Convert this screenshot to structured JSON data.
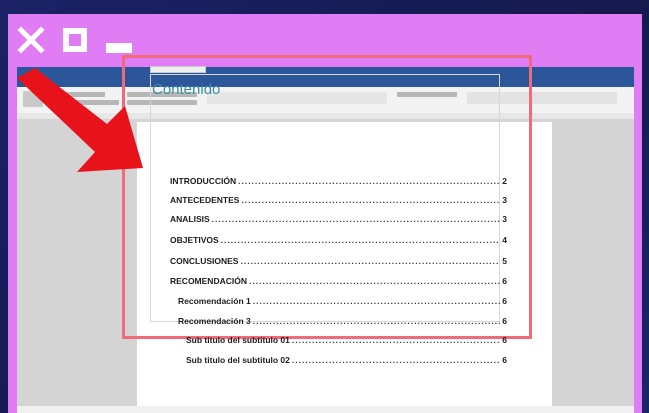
{
  "window_controls": {
    "close_icon": "close-x-icon",
    "maximize_icon": "maximize-square-icon",
    "minimize_icon": "minimize-bar-icon",
    "icon_color": "#ffffff"
  },
  "colors": {
    "frame": "#e07df5",
    "word_blue": "#2b579a",
    "toc_title": "#3c8ea3",
    "highlight": "#f06a78",
    "arrow": "#e8121a"
  },
  "document": {
    "toc_title": "Contenido",
    "entries": [
      {
        "label": "INTRODUCCIÓN",
        "page": "2"
      },
      {
        "label": "ANTECEDENTES",
        "page": "3"
      },
      {
        "label": "ANALISIS",
        "page": "3"
      },
      {
        "label": "OBJETIVOS",
        "page": "4"
      },
      {
        "label": "CONCLUSIONES",
        "page": "5"
      },
      {
        "label": "RECOMENDACIÓN",
        "page": "6"
      },
      {
        "label": "Recomendación 1",
        "page": "6"
      },
      {
        "label": "Recomendación 3",
        "page": "6"
      },
      {
        "label": "Sub titulo del subtitulo 01",
        "page": "6"
      },
      {
        "label": "Sub titulo del subtitulo 02",
        "page": "6"
      }
    ]
  },
  "pointer_arrow": "arrow-pointer-icon"
}
